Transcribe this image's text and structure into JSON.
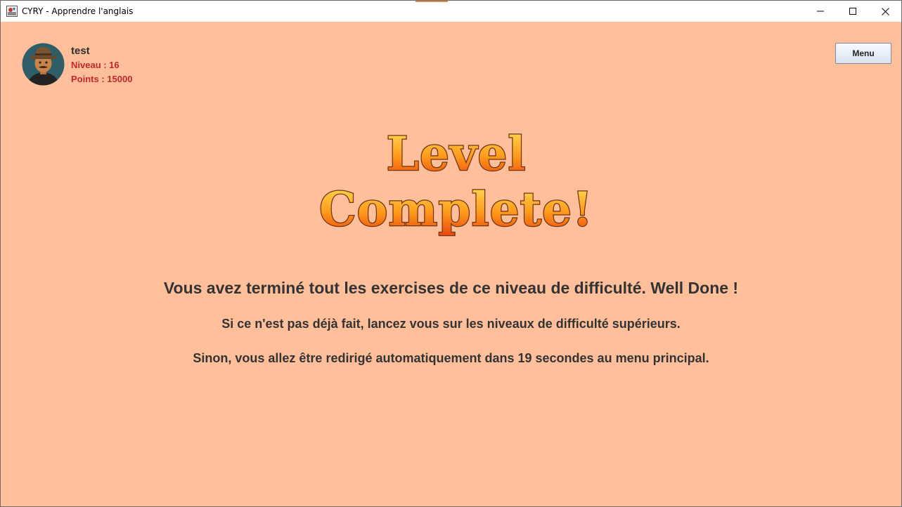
{
  "window": {
    "title": "CYRY - Apprendre l'anglais"
  },
  "user": {
    "name": "test",
    "level_text": "Niveau : 16",
    "points_text": "Points : 15000"
  },
  "header": {
    "menu_label": "Menu"
  },
  "banner": {
    "line1": "Level",
    "line2": "Complete!"
  },
  "messages": {
    "main": "Vous avez terminé tout les exercises de ce niveau de difficulté. Well Done !",
    "sub1": "Si ce n'est pas déjà fait, lancez vous sur les niveaux de difficulté supérieurs.",
    "sub2": "Sinon, vous allez être redirigé automatiquement dans 19 secondes au menu principal."
  },
  "colors": {
    "background": "#ffbf9b",
    "stat_text": "#c1272d",
    "body_text": "#333333",
    "banner_fill_top": "#ffd84a",
    "banner_fill_bottom": "#f05a10",
    "banner_stroke": "#7a3d12"
  },
  "icons": {
    "app": "app-icon",
    "minimize": "minimize-icon",
    "maximize": "maximize-icon",
    "close": "close-icon",
    "avatar": "avatar-cowboy"
  }
}
